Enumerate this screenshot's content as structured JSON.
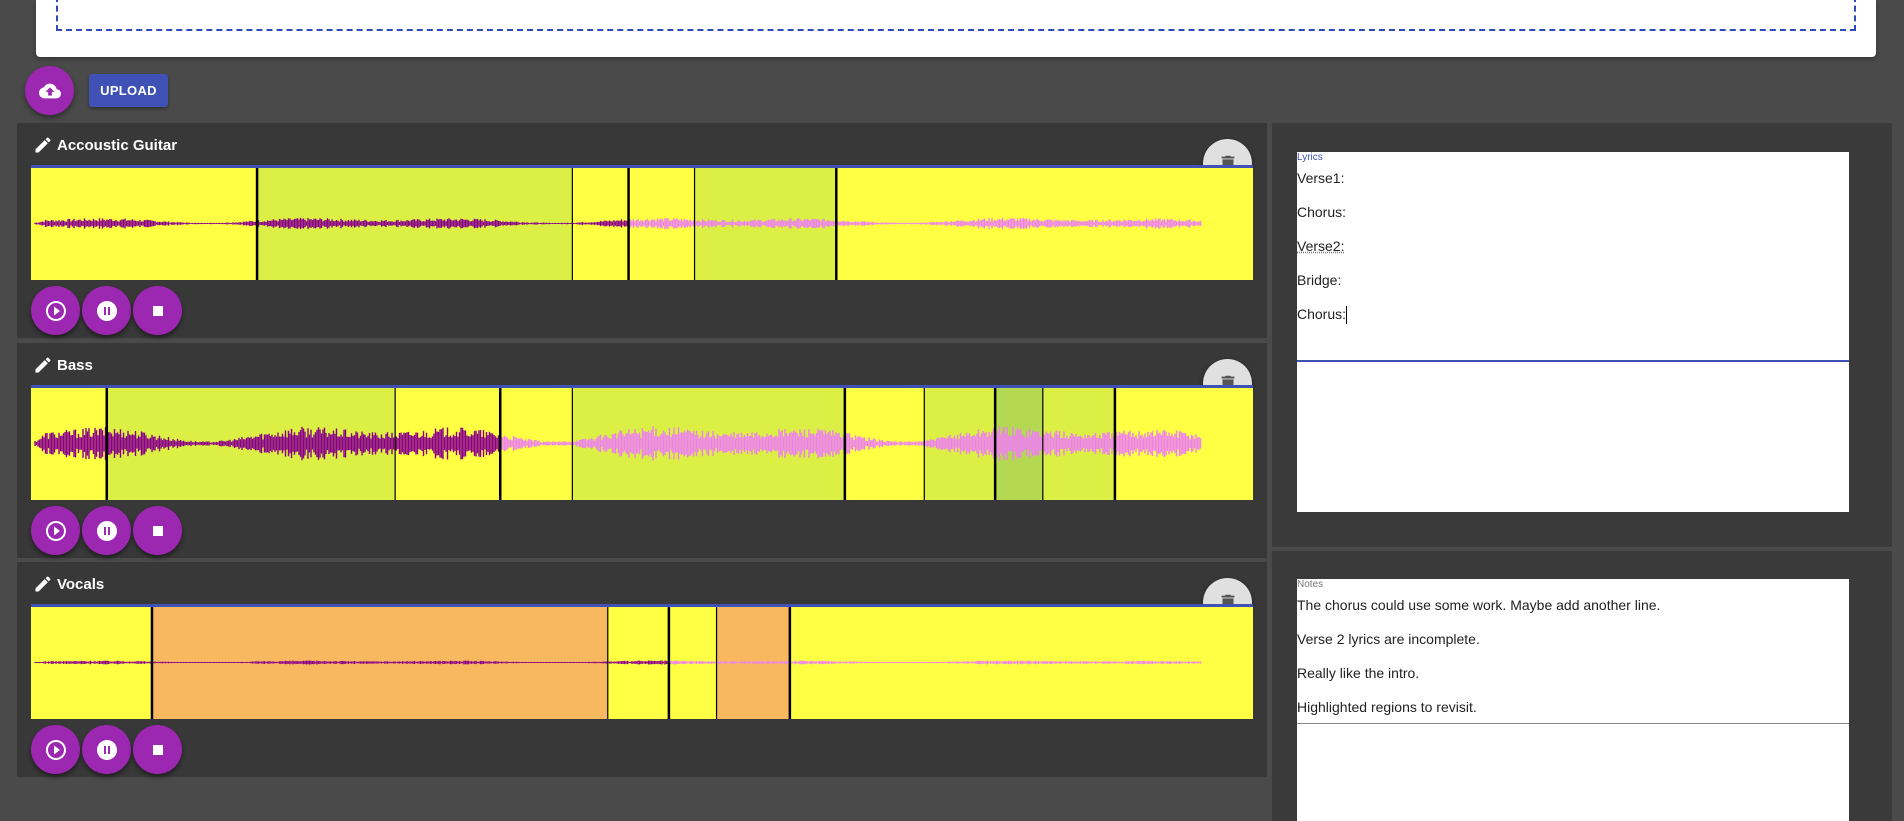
{
  "upload": {
    "label": "UPLOAD",
    "icon": "cloud-upload-icon"
  },
  "colors": {
    "purple": "#9c27b0",
    "indigo": "#3f51b5",
    "wave_bg": "#ffff44",
    "wave_played": "#8b008b",
    "wave_unplayed": "#ee82ee",
    "region_green": "#d8e84a",
    "region_orange": "#f7b860"
  },
  "tracks": [
    {
      "name": "Accoustic Guitar",
      "played_fraction": 0.49,
      "amplitude": 0.14,
      "markers": [
        0.185,
        0.443,
        0.489,
        0.543,
        0.659
      ],
      "regions": [
        [
          0.185,
          0.443,
          "green"
        ],
        [
          0.543,
          0.659,
          "green"
        ]
      ]
    },
    {
      "name": "Bass",
      "played_fraction": 0.385,
      "amplitude": 0.42,
      "markers": [
        0.062,
        0.298,
        0.384,
        0.443,
        0.666,
        0.731,
        0.789,
        0.828,
        0.887
      ],
      "regions": [
        [
          0.062,
          0.298,
          "green"
        ],
        [
          0.443,
          0.666,
          "green"
        ],
        [
          0.731,
          0.789,
          "green"
        ],
        [
          0.789,
          0.828,
          "olive"
        ],
        [
          0.828,
          0.887,
          "green"
        ]
      ]
    },
    {
      "name": "Vocals",
      "played_fraction": 0.522,
      "amplitude": 0.05,
      "markers": [
        0.099,
        0.472,
        0.522,
        0.561,
        0.621
      ],
      "regions": [
        [
          0.099,
          0.472,
          "orange"
        ],
        [
          0.561,
          0.621,
          "orange"
        ]
      ]
    }
  ],
  "lyrics": {
    "label": "Lyrics",
    "lines": [
      "Verse1:",
      "Chorus:",
      "Verse2:",
      "Bridge:",
      "Chorus:"
    ]
  },
  "notes": {
    "label": "Notes",
    "lines": [
      "The chorus could use some work.  Maybe add another line.",
      "Verse 2 lyrics are incomplete.",
      "Really like the intro.",
      "Highlighted regions to revisit."
    ]
  }
}
